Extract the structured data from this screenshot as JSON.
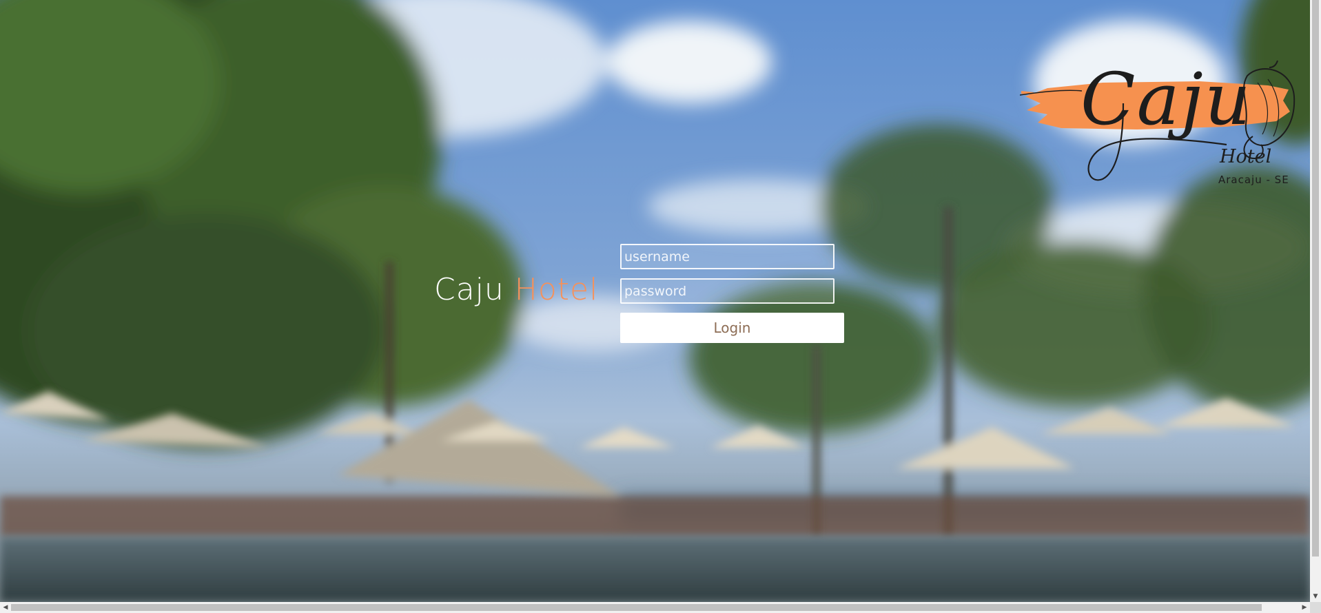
{
  "hero": {
    "title_primary": "Caju",
    "title_accent": "Hotel"
  },
  "login_form": {
    "username_placeholder": "username",
    "username_value": "",
    "password_placeholder": "password",
    "password_value": "",
    "submit_label": "Login"
  },
  "logo": {
    "wordmark": "Caju",
    "subtitle": "Hotel",
    "location": "Aracaju - SE"
  },
  "colors": {
    "accent": "#f6915a",
    "button_bg": "#ffffff",
    "button_text": "#8d6d55",
    "logo_brush": "#f6914f"
  },
  "scrollbars": {
    "vertical_up": "▲",
    "vertical_down": "▼",
    "horizontal_left": "◀",
    "horizontal_right": "▶"
  }
}
